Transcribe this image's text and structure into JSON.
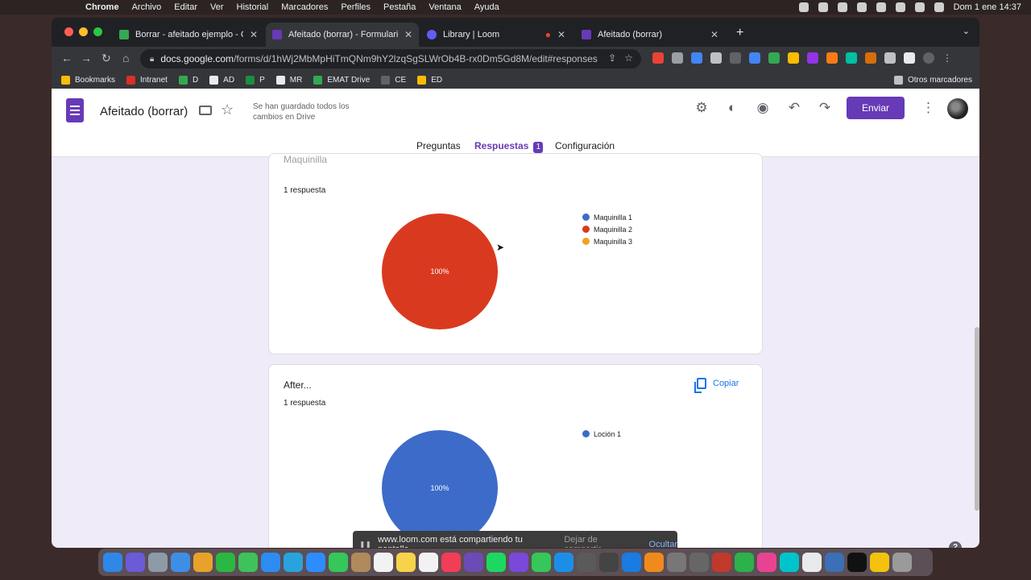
{
  "menubar": {
    "app_name": "Chrome",
    "items": [
      "Archivo",
      "Editar",
      "Ver",
      "Historial",
      "Marcadores",
      "Perfiles",
      "Pestaña",
      "Ventana",
      "Ayuda"
    ],
    "clock": "Dom 1 ene 14:37"
  },
  "browser": {
    "tabs": [
      {
        "label": "Borrar - afeitado ejemplo - Goo",
        "color": "#34a853"
      },
      {
        "label": "Afeitado (borrar) - Formularios",
        "color": "#673ab7"
      },
      {
        "label": "Library | Loom",
        "color": "#625df5"
      },
      {
        "label": "Afeitado (borrar)",
        "color": "#673ab7"
      }
    ],
    "url_host": "docs.google.com",
    "url_path": "/forms/d/1hWj2MbMpHiTmQNm9hY2lzqSgSLWrOb4B-rx0Dm5Gd8M/edit#responses",
    "bookmarks": [
      {
        "label": "Bookmarks",
        "color": "#fbbc04"
      },
      {
        "label": "Intranet",
        "color": "#d93025"
      },
      {
        "label": "D",
        "color": "#34a853"
      },
      {
        "label": "AD",
        "color": "#e8eaed"
      },
      {
        "label": "P",
        "color": "#1e8e3e"
      },
      {
        "label": "MR",
        "color": "#e8eaed"
      },
      {
        "label": "EMAT Drive",
        "color": "#34a853"
      },
      {
        "label": "CE",
        "color": "#5f6368"
      },
      {
        "label": "ED",
        "color": "#fbbc04"
      }
    ],
    "other_bookmarks": "Otros marcadores"
  },
  "form": {
    "title": "Afeitado (borrar)",
    "saved_status": "Se han guardado todos los cambios en Drive",
    "send_label": "Enviar",
    "tabs": {
      "questions": "Preguntas",
      "responses": "Respuestas",
      "responses_count": "1",
      "settings": "Configuración"
    },
    "cards": [
      {
        "title": "Maquinilla",
        "count": "1 respuesta",
        "pie_label": "100%",
        "pie_color": "#d93a1f",
        "legend": [
          {
            "label": "Maquinilla 1",
            "color": "#3c6bc9"
          },
          {
            "label": "Maquinilla 2",
            "color": "#d93a1f"
          },
          {
            "label": "Maquinilla 3",
            "color": "#f1a31d"
          }
        ]
      },
      {
        "title": "After...",
        "count": "1 respuesta",
        "copy_label": "Copiar",
        "pie_label": "100%",
        "pie_color": "#3c6bc9",
        "legend": [
          {
            "label": "Loción 1",
            "color": "#3c6bc9"
          }
        ]
      }
    ]
  },
  "loom": {
    "message": "www.loom.com está compartiendo tu pantalla.",
    "stop_label": "Dejar de compartir",
    "hide_label": "Ocultar"
  },
  "help_label": "?"
}
